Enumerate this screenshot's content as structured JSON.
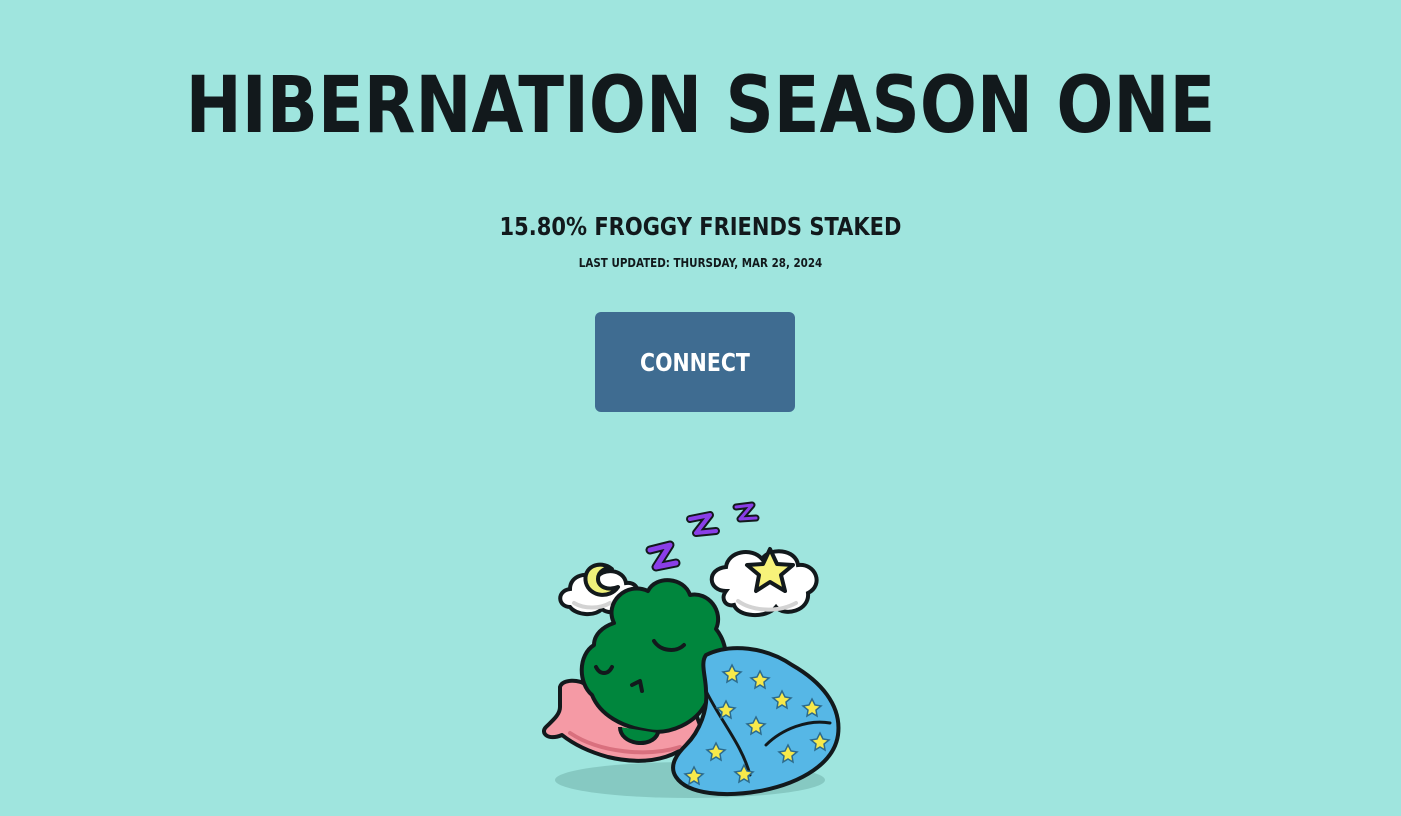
{
  "header": {
    "title": "HIBERNATION SEASON ONE"
  },
  "stats": {
    "staked_text": "15.80% FROGGY FRIENDS STAKED",
    "last_updated": "LAST UPDATED: THURSDAY, MAR 28, 2024"
  },
  "actions": {
    "connect_label": "CONNECT"
  },
  "illustration": {
    "icon": "sleeping-frog-illustration",
    "colors": {
      "background": "#9fe5de",
      "button": "#3f6c91",
      "frog": "#00863d",
      "blanket": "#56b7e6",
      "pillow": "#f59aa5",
      "zzz": "#8a3ee8",
      "star": "#f7f27a"
    }
  }
}
